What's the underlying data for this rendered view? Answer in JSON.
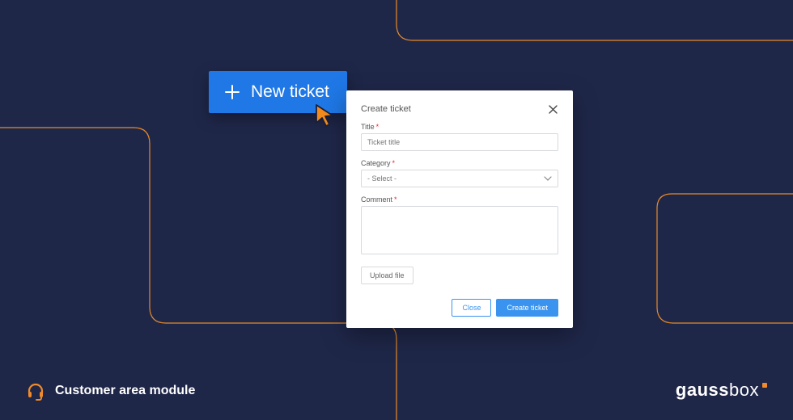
{
  "new_ticket": {
    "label": "New ticket"
  },
  "dialog": {
    "title": "Create ticket",
    "title_field": {
      "label": "Title",
      "placeholder": "Ticket title"
    },
    "category_field": {
      "label": "Category",
      "placeholder": "- Select -"
    },
    "comment_field": {
      "label": "Comment"
    },
    "upload_label": "Upload file",
    "close_label": "Close",
    "submit_label": "Create ticket"
  },
  "footer": {
    "module_label": "Customer area module",
    "brand_prefix": "gauss",
    "brand_suffix": "box"
  }
}
